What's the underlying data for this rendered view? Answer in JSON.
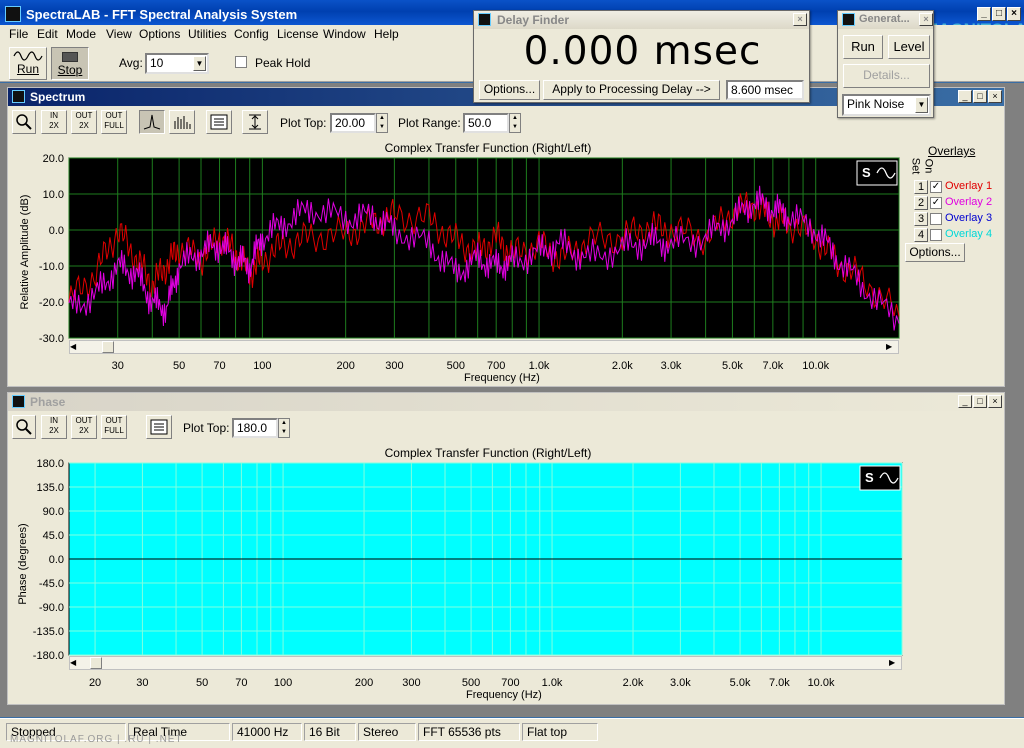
{
  "app": {
    "title": "SpectraLAB - FFT Spectral Analysis System",
    "watermark": "MAGNITOLA",
    "watermark_url": "MAGNITOLAF.ORG | .RU | .NET"
  },
  "menu": [
    "File",
    "Edit",
    "Mode",
    "View",
    "Options",
    "Utilities",
    "Config",
    "License",
    "Window",
    "Help"
  ],
  "toolbar": {
    "run_label": "Run",
    "stop_label": "Stop",
    "avg_label": "Avg:",
    "avg_value": "10",
    "peak_hold_label": "Peak Hold"
  },
  "delay_finder": {
    "title": "Delay Finder",
    "readout": "0.000 msec",
    "options_label": "Options...",
    "apply_label": "Apply to Processing Delay -->",
    "delay_value": "8.600 msec"
  },
  "generator": {
    "title": "Generat...",
    "run_label": "Run",
    "level_label": "Level",
    "details_label": "Details...",
    "signal_value": "Pink Noise"
  },
  "spectrum": {
    "window_title": "Spectrum",
    "plot_top_label": "Plot Top:",
    "plot_top_value": "20.00",
    "plot_range_label": "Plot Range:",
    "plot_range_value": "50.0",
    "overlays": {
      "header": "Overlays",
      "set_label": "Set",
      "on_label": "On",
      "items": [
        {
          "num": "1",
          "label": "Overlay 1",
          "checked": true,
          "color": "#e00000"
        },
        {
          "num": "2",
          "label": "Overlay 2",
          "checked": true,
          "color": "#e000e0"
        },
        {
          "num": "3",
          "label": "Overlay 3",
          "checked": false,
          "color": "#0000d0"
        },
        {
          "num": "4",
          "label": "Overlay 4",
          "checked": false,
          "color": "#00d8d8"
        }
      ],
      "options_label": "Options..."
    }
  },
  "phase": {
    "window_title": "Phase",
    "plot_top_label": "Plot Top:",
    "plot_top_value": "180.0"
  },
  "chart_data": [
    {
      "type": "line",
      "title": "Complex Transfer Function (Right/Left)",
      "xlabel": "Frequency (Hz)",
      "ylabel": "Relative Amplitude (dB)",
      "ylim": [
        -30,
        20
      ],
      "xlim": [
        20,
        20000
      ],
      "xscale": "log",
      "y_ticks": [
        "20.0",
        "10.0",
        "0.0",
        "-10.0",
        "-20.0",
        "-30.0"
      ],
      "x_ticks": [
        {
          "v": 30,
          "label": "30"
        },
        {
          "v": 50,
          "label": "50"
        },
        {
          "v": 70,
          "label": "70"
        },
        {
          "v": 100,
          "label": "100"
        },
        {
          "v": 200,
          "label": "200"
        },
        {
          "v": 300,
          "label": "300"
        },
        {
          "v": 500,
          "label": "500"
        },
        {
          "v": 700,
          "label": "700"
        },
        {
          "v": 1000,
          "label": "1.0k"
        },
        {
          "v": 2000,
          "label": "2.0k"
        },
        {
          "v": 3000,
          "label": "3.0k"
        },
        {
          "v": 5000,
          "label": "5.0k"
        },
        {
          "v": 7000,
          "label": "7.0k"
        },
        {
          "v": 10000,
          "label": "10.0k"
        }
      ],
      "background": "#000000",
      "grid": true,
      "grid_color": "#1e7d1e",
      "series": [
        {
          "name": "Overlay 1",
          "color": "#e00000",
          "x": [
            20,
            25,
            30,
            35,
            40,
            45,
            50,
            60,
            70,
            80,
            90,
            100,
            120,
            150,
            200,
            250,
            300,
            400,
            500,
            600,
            700,
            800,
            1000,
            1200,
            1500,
            2000,
            2500,
            3000,
            4000,
            5000,
            6000,
            7000,
            8000,
            10000,
            12000,
            15000,
            20000
          ],
          "y": [
            -20,
            -12,
            0,
            -8,
            -15,
            -10,
            -5,
            -8,
            -2,
            -6,
            -12,
            -8,
            -4,
            -2,
            -1,
            2,
            4,
            3,
            -3,
            -6,
            -2,
            -7,
            -4,
            -8,
            -3,
            -2,
            1,
            0,
            -2,
            5,
            7,
            3,
            2,
            -2,
            -9,
            -14,
            -24
          ]
        },
        {
          "name": "Overlay 2",
          "color": "#e000e0",
          "x": [
            20,
            25,
            30,
            35,
            40,
            45,
            50,
            60,
            70,
            80,
            90,
            100,
            120,
            150,
            200,
            250,
            300,
            400,
            500,
            600,
            700,
            800,
            1000,
            1200,
            1500,
            2000,
            2500,
            3000,
            4000,
            5000,
            6000,
            7000,
            8000,
            10000,
            12000,
            15000,
            20000
          ],
          "y": [
            -22,
            -18,
            -10,
            -12,
            -20,
            -22,
            -10,
            -6,
            -4,
            -8,
            -10,
            -2,
            2,
            6,
            3,
            4,
            0,
            -4,
            -12,
            -8,
            -10,
            -9,
            -6,
            -4,
            -8,
            -5,
            -3,
            -4,
            -2,
            3,
            8,
            6,
            4,
            0,
            -8,
            -16,
            -26
          ]
        }
      ]
    },
    {
      "type": "line",
      "title": "Complex Transfer Function (Right/Left)",
      "xlabel": "Frequency (Hz)",
      "ylabel": "Phase (degrees)",
      "ylim": [
        -180,
        180
      ],
      "xlim": [
        16,
        20000
      ],
      "xscale": "log",
      "y_ticks": [
        "180.0",
        "135.0",
        "90.0",
        "45.0",
        "0.0",
        "-45.0",
        "-90.0",
        "-135.0",
        "-180.0"
      ],
      "x_ticks": [
        {
          "v": 20,
          "label": "20"
        },
        {
          "v": 30,
          "label": "30"
        },
        {
          "v": 50,
          "label": "50"
        },
        {
          "v": 70,
          "label": "70"
        },
        {
          "v": 100,
          "label": "100"
        },
        {
          "v": 200,
          "label": "200"
        },
        {
          "v": 300,
          "label": "300"
        },
        {
          "v": 500,
          "label": "500"
        },
        {
          "v": 700,
          "label": "700"
        },
        {
          "v": 1000,
          "label": "1.0k"
        },
        {
          "v": 2000,
          "label": "2.0k"
        },
        {
          "v": 3000,
          "label": "3.0k"
        },
        {
          "v": 5000,
          "label": "5.0k"
        },
        {
          "v": 7000,
          "label": "7.0k"
        },
        {
          "v": 10000,
          "label": "10.0k"
        }
      ],
      "background": "#00ffff",
      "grid": true,
      "grid_color": "#7fffe0",
      "series": [
        {
          "name": "",
          "color": "#000000",
          "x": [
            16,
            20000
          ],
          "y": [
            0,
            0
          ]
        }
      ]
    }
  ],
  "status": [
    "Stopped",
    "Real Time",
    "41000 Hz",
    "16 Bit",
    "Stereo",
    "FFT 65536 pts",
    "Flat top"
  ]
}
